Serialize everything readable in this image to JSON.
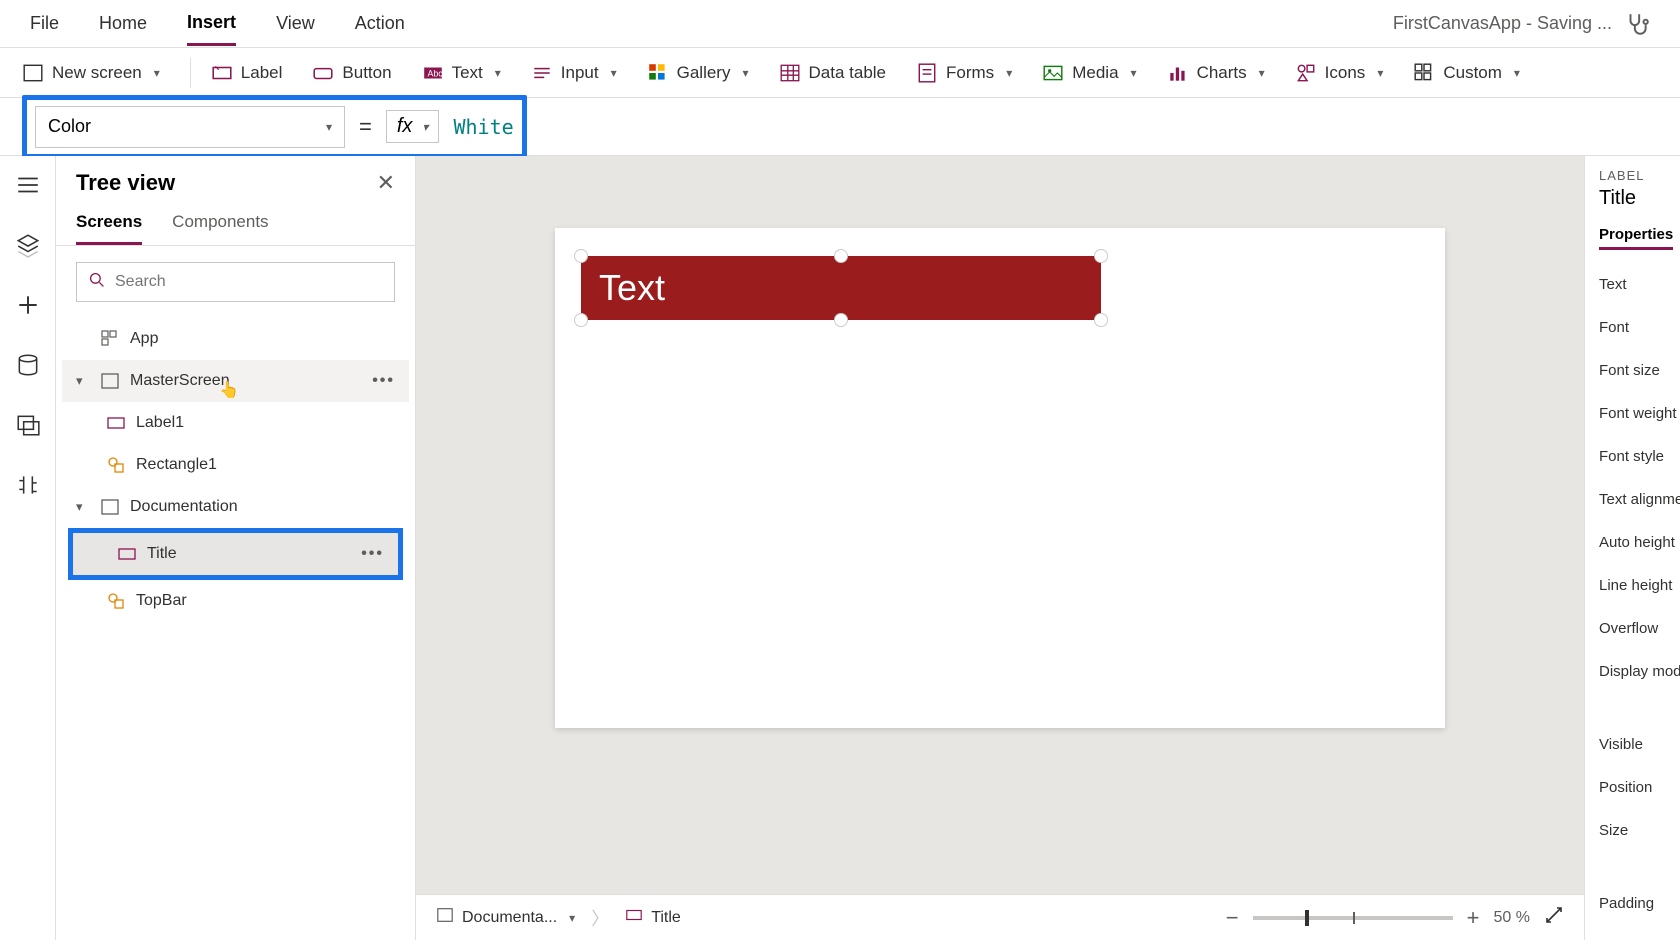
{
  "menubar": {
    "items": [
      "File",
      "Home",
      "Insert",
      "View",
      "Action"
    ],
    "active": "Insert",
    "status": "FirstCanvasApp - Saving ..."
  },
  "ribbon": {
    "new_screen": "New screen",
    "label": "Label",
    "button": "Button",
    "text": "Text",
    "input": "Input",
    "gallery": "Gallery",
    "data_table": "Data table",
    "forms": "Forms",
    "media": "Media",
    "charts": "Charts",
    "icons": "Icons",
    "custom": "Custom"
  },
  "formula": {
    "property": "Color",
    "value": "White"
  },
  "tree": {
    "title": "Tree view",
    "tabs": {
      "screens": "Screens",
      "components": "Components"
    },
    "search_placeholder": "Search",
    "app": "App",
    "master": "MasterScreen",
    "label1": "Label1",
    "rect1": "Rectangle1",
    "doc": "Documentation",
    "title_item": "Title",
    "topbar": "TopBar"
  },
  "canvas": {
    "label_text": "Text"
  },
  "breadcrumb": {
    "screen": "Documenta...",
    "control": "Title"
  },
  "zoom": {
    "value": "50",
    "unit": "%"
  },
  "props": {
    "type": "LABEL",
    "name": "Title",
    "tab": "Properties",
    "items": [
      "Text",
      "Font",
      "Font size",
      "Font weight",
      "Font style",
      "Text alignme",
      "Auto height",
      "Line height",
      "Overflow",
      "Display mod"
    ],
    "group2": [
      "Visible",
      "Position",
      "Size",
      "Padding"
    ]
  }
}
